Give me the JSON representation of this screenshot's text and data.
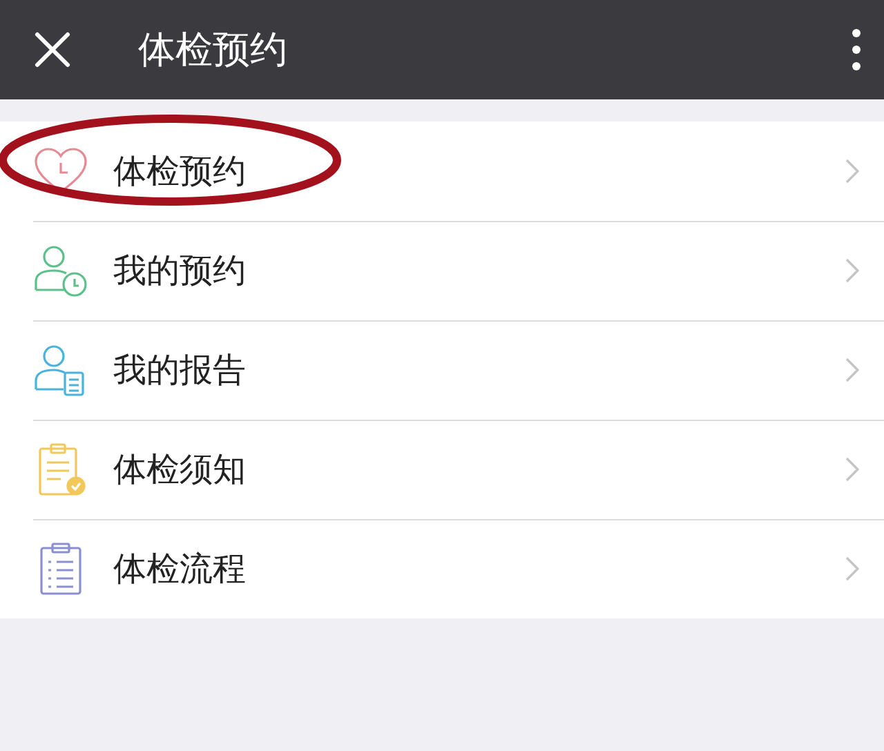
{
  "header": {
    "title": "体检预约"
  },
  "menu": [
    {
      "label": "体检预约",
      "kind": "heart",
      "highlighted": true
    },
    {
      "label": "我的预约",
      "kind": "person-clock",
      "highlighted": false
    },
    {
      "label": "我的报告",
      "kind": "person-doc",
      "highlighted": false
    },
    {
      "label": "体检须知",
      "kind": "clipboard-check",
      "highlighted": false
    },
    {
      "label": "体检流程",
      "kind": "clipboard-list",
      "highlighted": false
    }
  ]
}
